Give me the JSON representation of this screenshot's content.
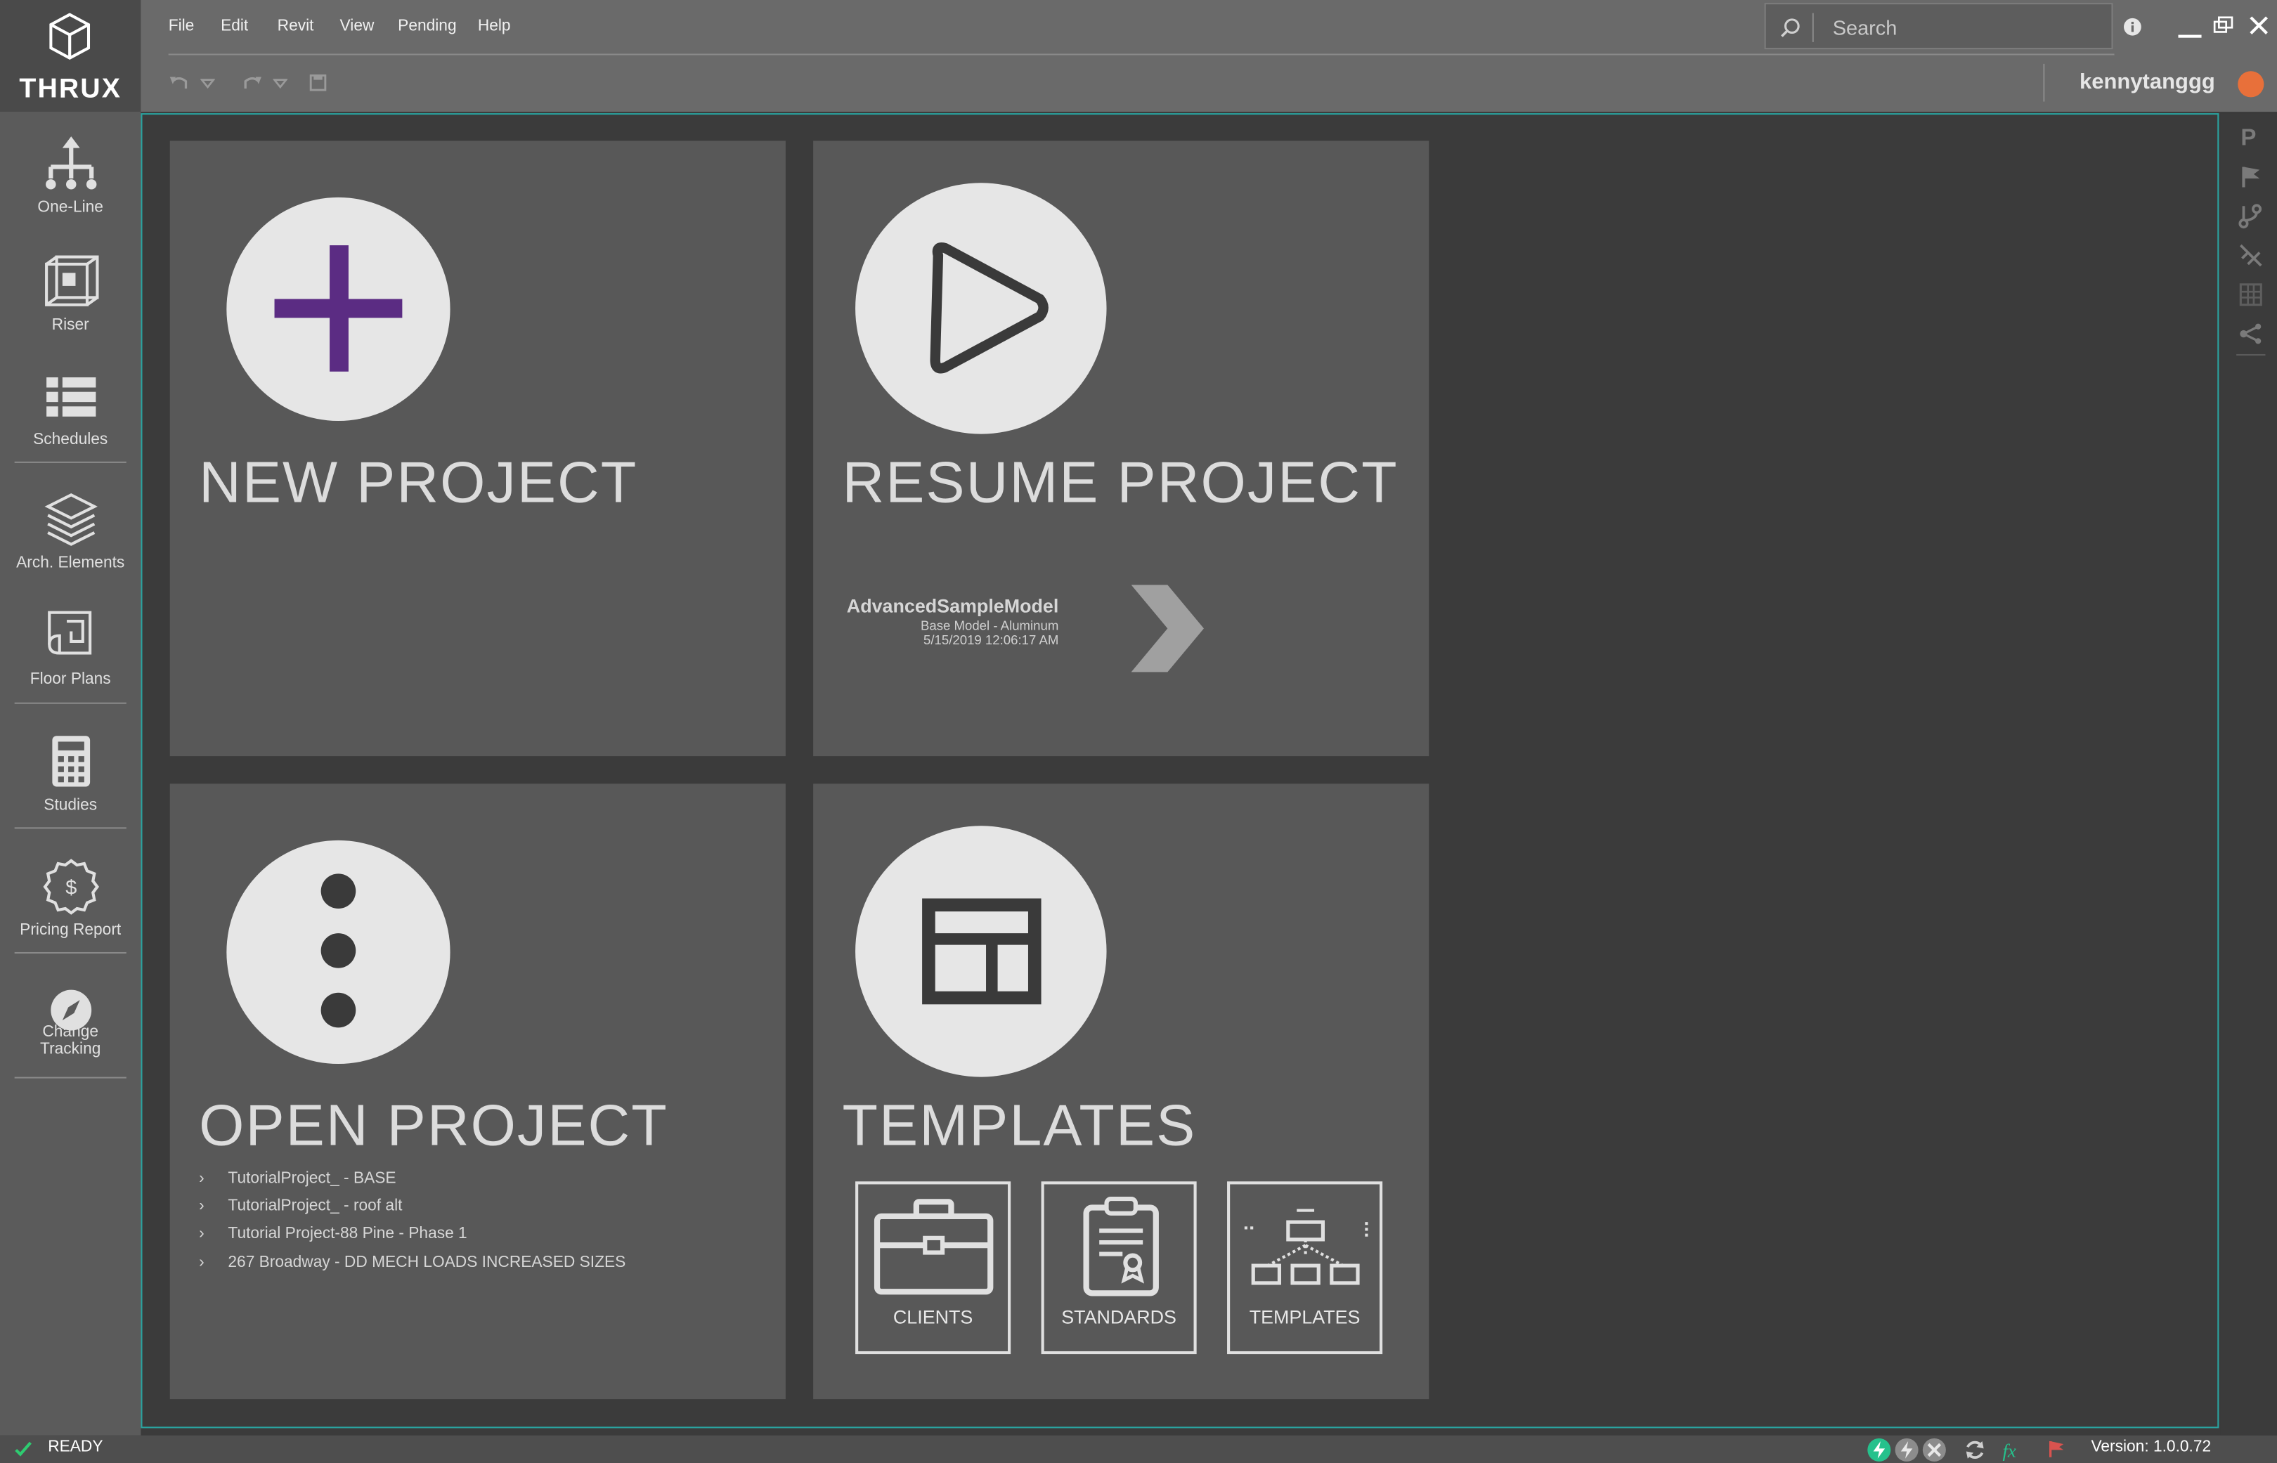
{
  "app": {
    "logo_text": "THRUX"
  },
  "menu": [
    "File",
    "Edit",
    "Revit",
    "View",
    "Pending",
    "Help"
  ],
  "search": {
    "placeholder": "Search"
  },
  "user": {
    "name": "kennytanggg"
  },
  "sidebar": {
    "items": [
      {
        "label": "One-Line",
        "icon": "one-line-icon"
      },
      {
        "label": "Riser",
        "icon": "cube-icon"
      },
      {
        "label": "Schedules",
        "icon": "list-icon"
      },
      {
        "label": "Arch. Elements",
        "icon": "layers-icon"
      },
      {
        "label": "Floor Plans",
        "icon": "blueprint-icon"
      },
      {
        "label": "Studies",
        "icon": "calculator-icon"
      },
      {
        "label": "Pricing Report",
        "icon": "dollar-badge-icon"
      },
      {
        "label": "Change",
        "label2": "Tracking",
        "icon": "compass-icon"
      }
    ]
  },
  "tiles": {
    "new_project": {
      "title": "NEW PROJECT"
    },
    "resume_project": {
      "title": "RESUME PROJECT",
      "model_name": "AdvancedSampleModel",
      "model_sub": "Base Model - Aluminum",
      "model_date": "5/15/2019 12:06:17 AM"
    },
    "open_project": {
      "title": "OPEN PROJECT",
      "recent": [
        "TutorialProject_ - BASE",
        "TutorialProject_ - roof alt",
        "Tutorial Project-88 Pine - Phase 1",
        "267 Broadway - DD MECH LOADS INCREASED SIZES"
      ]
    },
    "templates": {
      "title": "TEMPLATES",
      "buttons": [
        "CLIENTS",
        "STANDARDS",
        "TEMPLATES"
      ]
    }
  },
  "status": {
    "text": "READY",
    "version_label": "Version:",
    "version": "1.0.0.72"
  },
  "colors": {
    "accent": "#2aa3a0",
    "plus": "#5b2c83",
    "avatar": "#e8703a"
  }
}
